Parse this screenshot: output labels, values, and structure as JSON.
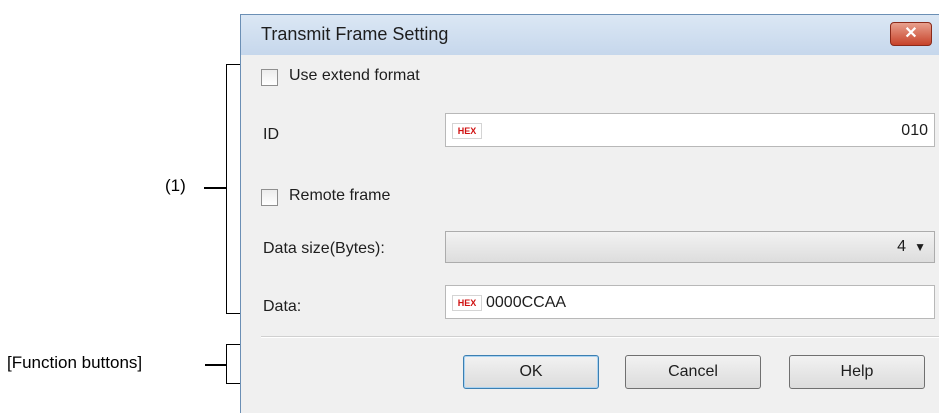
{
  "annotations": {
    "section1_label": "(1)",
    "function_buttons_label": "[Function buttons]"
  },
  "dialog": {
    "title": "Transmit Frame Setting",
    "close_glyph": "✕"
  },
  "form": {
    "use_extend_format": {
      "label": "Use extend format",
      "checked": false
    },
    "id": {
      "label": "ID",
      "badge": "HEX",
      "value": "010"
    },
    "remote_frame": {
      "label": "Remote frame",
      "checked": false
    },
    "data_size": {
      "label": "Data size(Bytes):",
      "value": "4",
      "arrow": "▼"
    },
    "data": {
      "label": "Data:",
      "badge": "HEX",
      "value": "0000CCAA"
    }
  },
  "buttons": {
    "ok": "OK",
    "cancel": "Cancel",
    "help": "Help"
  }
}
